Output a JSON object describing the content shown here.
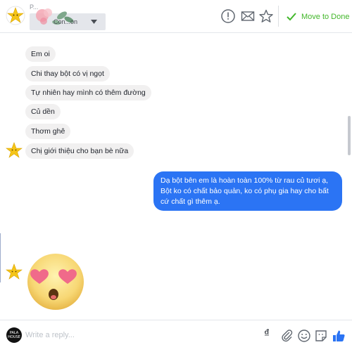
{
  "header": {
    "name": "P...",
    "status_label": "Con...on",
    "done_label": "Move to Done",
    "icons": [
      "alert-icon",
      "mail-icon",
      "star-icon",
      "check-icon"
    ]
  },
  "messages_in": [
    {
      "text": "Em oi"
    },
    {
      "text": "Chi thay bột có vị ngọt"
    },
    {
      "text": "Tự nhiên hay mình có thêm đường"
    },
    {
      "text": "Củ dền"
    },
    {
      "text": "Thơm ghê"
    },
    {
      "text": "Chị giới thiệu cho bạn bè nữa"
    }
  ],
  "message_out": {
    "text": "Dạ bột bên em là hoàn toàn 100% từ rau củ tươi ạ, Bột ko có chất bảo quản, ko có phụ gia hay cho bất cứ chất gì thêm ạ."
  },
  "composer": {
    "placeholder": "Write a reply...",
    "logo_line1": "PALA",
    "logo_line2": "HOUSE",
    "currency_symbol": "₫"
  },
  "colors": {
    "accent_blue": "#2b74f4",
    "done_green": "#42b72a",
    "incoming_bubble": "#f1f0f0"
  }
}
